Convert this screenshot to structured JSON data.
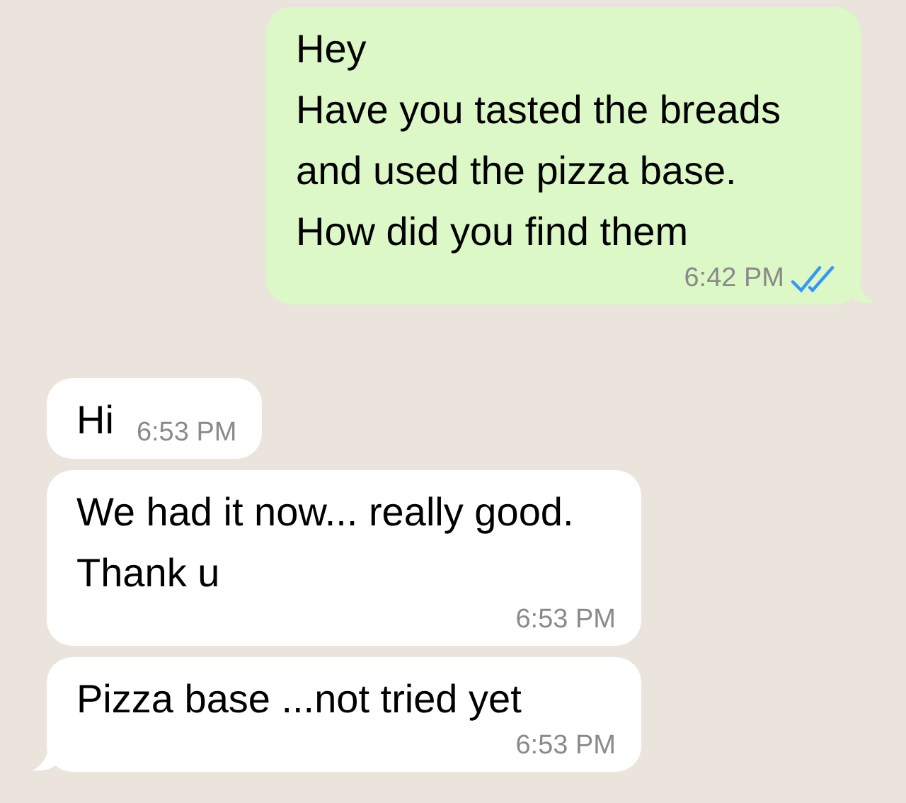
{
  "messages": [
    {
      "kind": "outgoing",
      "lines": [
        "Hey",
        "Have you tasted the breads",
        "and used the pizza base.",
        "How did you find them"
      ],
      "time": "6:42 PM",
      "read": true,
      "tail": true
    },
    {
      "kind": "incoming",
      "lines": [
        "Hi"
      ],
      "time": "6:53 PM",
      "tail": false
    },
    {
      "kind": "incoming",
      "lines": [
        "We had it now... really good.",
        "Thank u"
      ],
      "time": "6:53 PM",
      "tail": false
    },
    {
      "kind": "incoming",
      "lines": [
        "Pizza base ...not tried yet"
      ],
      "time": "6:53 PM",
      "tail": true
    }
  ]
}
